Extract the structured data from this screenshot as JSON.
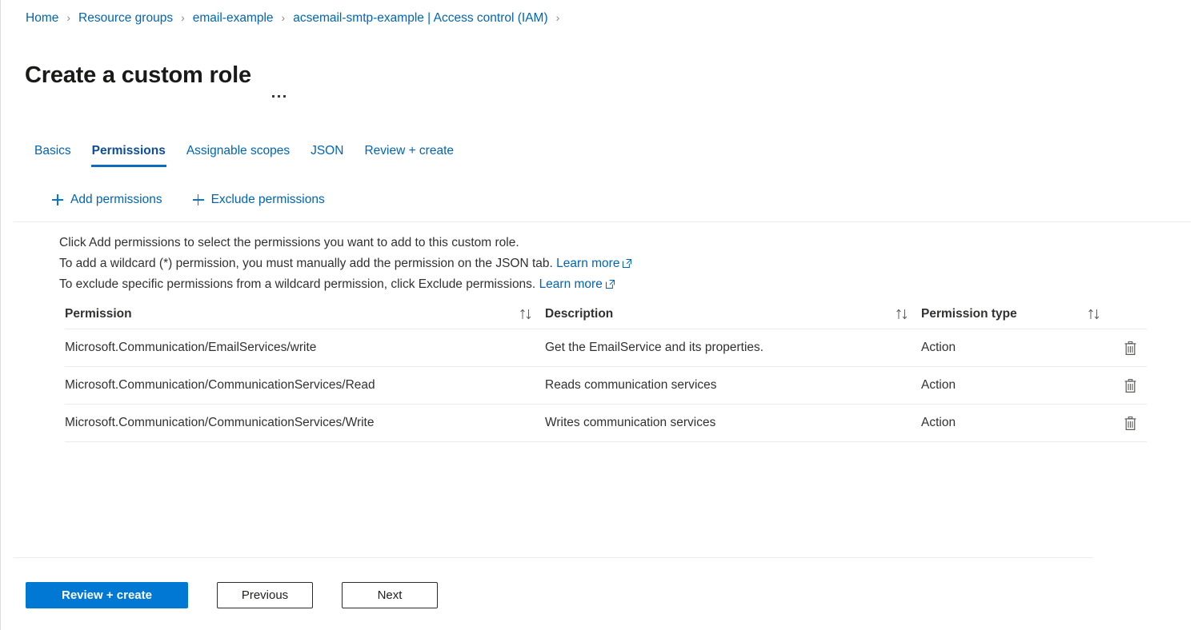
{
  "breadcrumb": {
    "separator": "›",
    "items": [
      {
        "label": "Home"
      },
      {
        "label": "Resource groups"
      },
      {
        "label": "email-example"
      },
      {
        "label": "acsemail-smtp-example | Access control (IAM)"
      }
    ]
  },
  "header": {
    "title": "Create a custom role",
    "more_label": "More options"
  },
  "tabs": [
    {
      "label": "Basics",
      "active": false
    },
    {
      "label": "Permissions",
      "active": true
    },
    {
      "label": "Assignable scopes",
      "active": false
    },
    {
      "label": "JSON",
      "active": false
    },
    {
      "label": "Review + create",
      "active": false
    }
  ],
  "commandbar": [
    {
      "label": "Add permissions",
      "icon": "plus-icon"
    },
    {
      "label": "Exclude permissions",
      "icon": "plus-icon"
    }
  ],
  "description": {
    "line1": "Click Add permissions to select the permissions you want to add to this custom role.",
    "line2_text": "To add a wildcard (*) permission, you must manually add the permission on the JSON tab.",
    "line2_link": "Learn more",
    "line3_text": "To exclude specific permissions from a wildcard permission, click Exclude permissions.",
    "line3_link": "Learn more"
  },
  "table": {
    "columns": [
      {
        "label": "Permission",
        "sortable": true,
        "sort_icon": "sort-arrows-icon"
      },
      {
        "label": "Description",
        "sortable": true,
        "sort_icon": "sort-arrows-icon"
      },
      {
        "label": "Permission type",
        "sortable": true,
        "sort_icon": "sort-arrows-icon"
      }
    ],
    "rows": [
      {
        "permission": "Microsoft.Communication/EmailServices/write",
        "description": "Get the EmailService and its properties.",
        "type": "Action",
        "delete_label": "Delete permission"
      },
      {
        "permission": "Microsoft.Communication/CommunicationServices/Read",
        "description": "Reads communication services",
        "type": "Action",
        "delete_label": "Delete permission"
      },
      {
        "permission": "Microsoft.Communication/CommunicationServices/Write",
        "description": "Writes communication services",
        "type": "Action",
        "delete_label": "Delete permission"
      }
    ]
  },
  "footer": {
    "review_create": "Review + create",
    "previous": "Previous",
    "next": "Next"
  },
  "colors": {
    "accent": "#0078d4",
    "link": "#0065b3",
    "text": "#323130",
    "divider": "#edebe9"
  }
}
